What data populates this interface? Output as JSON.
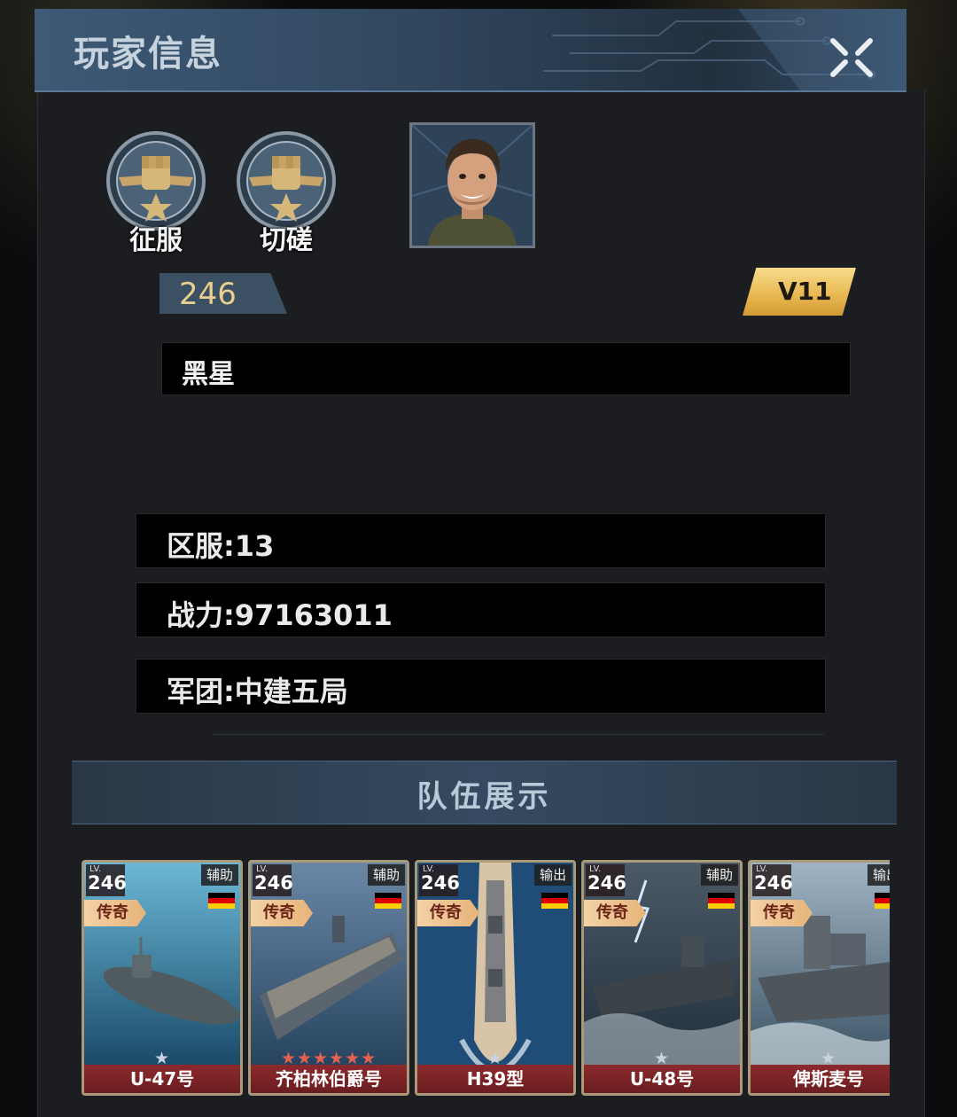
{
  "header": {
    "title": "玩家信息",
    "close_icon": "close-x-icon"
  },
  "actions": [
    {
      "label": "征服",
      "icon": "fist-emblem-icon"
    },
    {
      "label": "切磋",
      "icon": "fist-emblem-icon"
    }
  ],
  "player": {
    "avatar": "player-avatar-portrait",
    "level": "246",
    "vip": "V11",
    "name": "黑星"
  },
  "info": {
    "server": "区服:13",
    "power": "战力:97163011",
    "legion": "军团:中建五局"
  },
  "team": {
    "title": "队伍展示",
    "cards": [
      {
        "lv_label": "LV.",
        "level": "246",
        "role": "辅助",
        "flag": "germany-flag",
        "rarity": "传奇",
        "name": "U-47号",
        "stars": "★"
      },
      {
        "lv_label": "LV.",
        "level": "246",
        "role": "辅助",
        "flag": "germany-flag",
        "rarity": "传奇",
        "name": "齐柏林伯爵号",
        "stars": "★★★★★★"
      },
      {
        "lv_label": "LV.",
        "level": "246",
        "role": "输出",
        "flag": "germany-flag",
        "rarity": "传奇",
        "name": "H39型",
        "stars": "★"
      },
      {
        "lv_label": "LV.",
        "level": "246",
        "role": "辅助",
        "flag": "germany-flag",
        "rarity": "传奇",
        "name": "U-48号",
        "stars": "★"
      },
      {
        "lv_label": "LV.",
        "level": "246",
        "role": "输出",
        "flag": "germany-flag",
        "rarity": "传奇",
        "name": "俾斯麦号",
        "stars": "★"
      }
    ]
  },
  "colors": {
    "header_blue": "#3e5a77",
    "gold_text": "#e9cf8f",
    "vip_gold": "#e7b64f",
    "card_name_red": "#8c2a2d",
    "star_red": "#e4614f",
    "star_silver": "#c9d4e0"
  }
}
